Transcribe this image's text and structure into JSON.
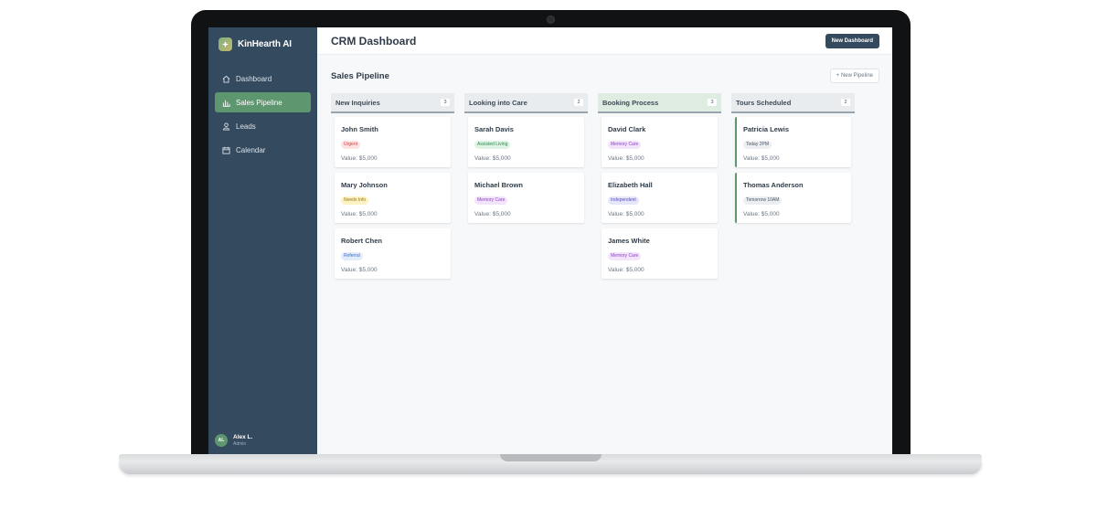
{
  "app": {
    "brand": "KinHearth AI",
    "page_title": "CRM Dashboard",
    "new_dashboard_label": "New Dashboard"
  },
  "sidebar": {
    "items": [
      {
        "label": "Dashboard",
        "icon": "home-icon",
        "active": false
      },
      {
        "label": "Sales Pipeline",
        "icon": "bar-chart-icon",
        "active": true
      },
      {
        "label": "Leads",
        "icon": "users-icon",
        "active": false
      },
      {
        "label": "Calendar",
        "icon": "calendar-icon",
        "active": false
      }
    ],
    "user": {
      "initials": "AL",
      "name": "Alex L.",
      "role": "Admin"
    }
  },
  "pipeline": {
    "title": "Sales Pipeline",
    "new_pipeline_label": "+ New Pipeline",
    "columns": [
      {
        "title": "New Inquiries",
        "count": "3",
        "cards": [
          {
            "name": "John Smith",
            "tag": "Urgent",
            "tag_bg": "#fde3e3",
            "tag_fg": "#d0443f",
            "value": "Value: $5,000"
          },
          {
            "name": "Mary Johnson",
            "tag": "Needs Info",
            "tag_bg": "#fdf2c4",
            "tag_fg": "#9a7a12",
            "value": "Value: $5,000"
          },
          {
            "name": "Robert Chen",
            "tag": "Referral",
            "tag_bg": "#e2ecfb",
            "tag_fg": "#3f6fc4",
            "value": "Value: $5,000"
          }
        ]
      },
      {
        "title": "Looking into Care",
        "count": "2",
        "cards": [
          {
            "name": "Sarah Davis",
            "tag": "Assisted Living",
            "tag_bg": "#dff3e5",
            "tag_fg": "#2f8a4f",
            "value": "Value: $5,000"
          },
          {
            "name": "Michael Brown",
            "tag": "Memory Care",
            "tag_bg": "#f1e4fb",
            "tag_fg": "#9443c8",
            "value": "Value: $5,000"
          }
        ]
      },
      {
        "title": "Booking Process",
        "count": "3",
        "cards": [
          {
            "name": "David Clark",
            "tag": "Memory Care",
            "tag_bg": "#f1e4fb",
            "tag_fg": "#9443c8",
            "value": "Value: $5,000"
          },
          {
            "name": "Elizabeth Hall",
            "tag": "Independent",
            "tag_bg": "#e6e6fb",
            "tag_fg": "#5a52c0",
            "value": "Value: $5,000"
          },
          {
            "name": "James White",
            "tag": "Memory Care",
            "tag_bg": "#f1e4fb",
            "tag_fg": "#9443c8",
            "value": "Value: $5,000"
          }
        ]
      },
      {
        "title": "Tours Scheduled",
        "count": "2",
        "cards": [
          {
            "name": "Patricia Lewis",
            "tag": "Today 2PM",
            "tag_bg": "#eceef1",
            "tag_fg": "#4a5664",
            "value": "Value: $5,000"
          },
          {
            "name": "Thomas Anderson",
            "tag": "Tomorrow 10AM",
            "tag_bg": "#eceef1",
            "tag_fg": "#4a5664",
            "value": "Value: $5,000"
          }
        ]
      }
    ]
  },
  "colors": {
    "sidebar": "#344a5f",
    "accent": "#5e9670"
  }
}
